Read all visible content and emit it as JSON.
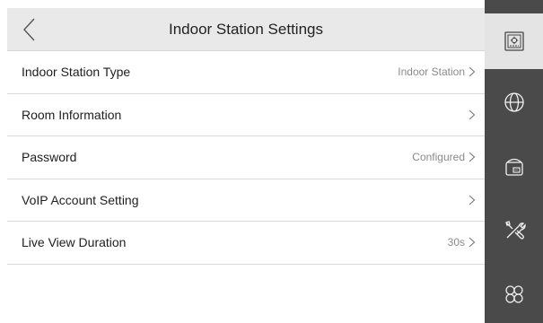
{
  "header": {
    "title": "Indoor Station Settings"
  },
  "settings": {
    "items": [
      {
        "label": "Indoor Station Type",
        "value": "Indoor Station"
      },
      {
        "label": "Room Information",
        "value": ""
      },
      {
        "label": "Password",
        "value": "Configured"
      },
      {
        "label": "VoIP Account Setting",
        "value": ""
      },
      {
        "label": "Live View Duration",
        "value": "30s"
      }
    ]
  },
  "sidebar": {
    "active_index": 0,
    "icons": [
      "device-settings-icon",
      "globe-icon",
      "intercom-device-icon",
      "tools-icon",
      "apps-icon"
    ]
  },
  "colors": {
    "sidebar_bg": "#4a4a4a",
    "sidebar_active_bg": "#e4e4e4",
    "header_bg": "#e9e9e9",
    "divider": "#d9d9d9",
    "value_text": "#8a8a8a"
  }
}
